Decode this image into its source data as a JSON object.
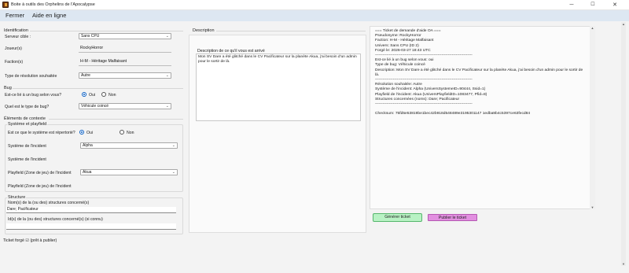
{
  "window": {
    "title": "Boite à outils des Orphelins de l'Apocalypse",
    "controls": {
      "minimize": "─",
      "maximize": "☐",
      "close": "✕"
    }
  },
  "menu": {
    "items": [
      "Fermer",
      "Aide en ligne"
    ]
  },
  "identification": {
    "title": "Identification",
    "server_label": "Serveur cible :",
    "server_value": "Sans CPU",
    "player_label": "Joueur(s)",
    "player_value": "RockyHorror",
    "faction_label": "Faction(s)",
    "faction_value": "H-M - Héritage Malfaisant",
    "resolution_label": "Type de résolution souhaitée",
    "resolution_value": "Autre"
  },
  "bug": {
    "title": "Bug",
    "is_bug_label": "Est-ce lié à un bug selon vous?",
    "yes": "Oui",
    "no": "Non",
    "is_bug": "yes",
    "type_label": "Quel est le type de bug?",
    "type_value": "Véhicule coincé"
  },
  "context": {
    "title": "Éléments de contexte",
    "system_title": "Système et playfield",
    "listed_label": "Est ce que le système est répertorié?",
    "yes": "Oui",
    "no": "Non",
    "listed": "yes",
    "system_label": "Système de l'incident",
    "system_value": "Alpha",
    "system_free_label": "Système de l'incident",
    "playfield_label": "Playfield (Zone de jeu) de l'incident",
    "playfield_value": "Akua",
    "playfield_free_label": "Playfield (Zone de jeu) de l'incident"
  },
  "structure": {
    "title": "Structure",
    "names_label": "Nom(s) de la (ou des) structures concerné(s)",
    "names_value": "Dare; Pacificateur",
    "ids_label": "Id(s) de la (ou des) structures concerné(s) (si connu)",
    "ids_value": ""
  },
  "footer": {
    "status": "Ticket forgé ☑ (prêt à publier)"
  },
  "description": {
    "group_title": "Description",
    "label": "Description de ce qu'il vous est arrivé",
    "text": "Mon SV Dare a été glitché dans le CV Pacificateur sur la planète Akua, j'ai besoin d'un admin pour le sortir de là."
  },
  "ticket": {
    "lines": [
      "=== Ticket de demande d'aide OA ===",
      "Pseudonyme: RockyHorror",
      "Faction: H-M - Héritage Malfaisant",
      "Univers: Sans CPU (ID 2)",
      "Forgé le: 2026-03-27 18:43 UTC",
      "----------------------------------------------------------------------------",
      "Est-ce lié à un bug selon vous: oui",
      "Type de bug: Véhicule coincé",
      "Description: Mon SV Dare a été glitché dans le CV Pacificateur sur la planète Akua, j'ai besoin d'un admin pour le sortir de là.",
      "----------------------------------------------------------------------------",
      "Résolution souhaitée: Autre",
      "Système de l'incident: Alpha (UniversSystemeID=90444, Ssid=1)",
      "Playfield de l'incident: Akua (UniversPlayfieldID=1083477, Pfid=8)",
      "Structures concernées (noms): Dare; Pacificateur",
      "----------------------------------------------------------------------------",
      "",
      "Checksum: 75fd5e53819be1bec42b918d548489e3195301147 1edba9b4c5397ce63fecd84"
    ],
    "generate_button": "Générer ticket",
    "publish_button": "Publier le ticket"
  }
}
